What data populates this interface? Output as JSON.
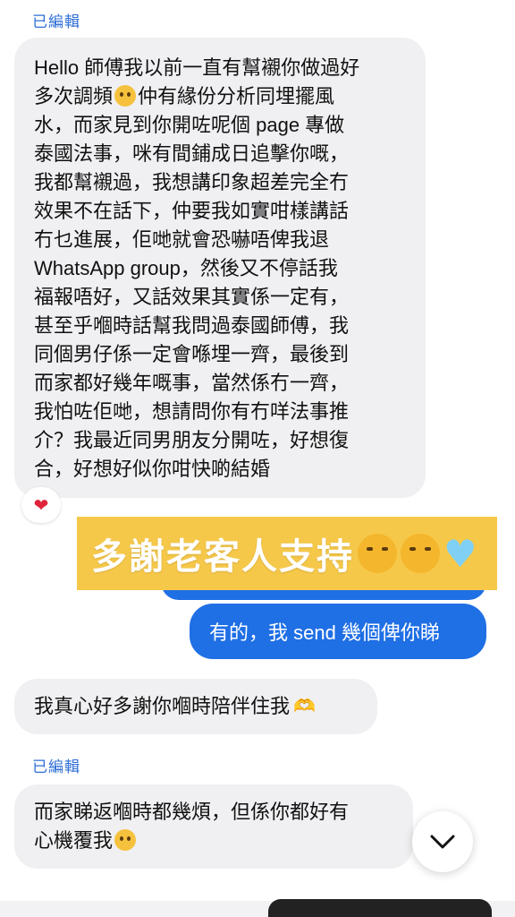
{
  "messages": {
    "edited_label_1": "已編輯",
    "message_1_lines": [
      "Hello 師傅我以前一直有幫襯你做過好",
      "多次調頻",
      "仲有緣份分析同埋擺風",
      "水，而家見到你開咗呢個 page 專做",
      "泰國法事，咪有間鋪成日追擊你嘅，",
      "我都幫襯過，我想講印象超差完全冇",
      "效果不在話下，仲要我如實咁樣講話",
      "冇乜進展，佢哋就會恐嚇唔俾我退",
      "WhatsApp group，然後又不停話我",
      "福報唔好，又話效果其實係一定有，",
      "甚至乎嗰時話幫我問過泰國師傅，我",
      "同個男仔係一定會喺埋一齊，最後到",
      "而家都好幾年嘅事，當然係冇一齊，",
      "我怕咗佢哋，想請問你有冇咩法事推",
      "介？我最近同男朋友分開咗，好想復",
      "合，好想好似你咁快啲結婚"
    ],
    "reaction_heart": "❤",
    "banner_text": "多謝老客人支持",
    "banner_heart": "♥",
    "reply_1": "有的，我 send 幾個俾你睇",
    "message_2": "我真心好多謝你嗰時陪伴住我",
    "message_2_hands": "🫶",
    "edited_label_2": "已編輯",
    "message_3_line1": "而家睇返嗰時都幾煩，但係你都好有",
    "message_3_line2": "心機覆我"
  },
  "icons": {
    "scroll_down": "chevron-down-icon"
  },
  "colors": {
    "incoming_bubble": "#f0f0f2",
    "outgoing_bubble": "#1f6fe5",
    "edited_label": "#2f6fd6",
    "banner": "#f6c84a"
  }
}
